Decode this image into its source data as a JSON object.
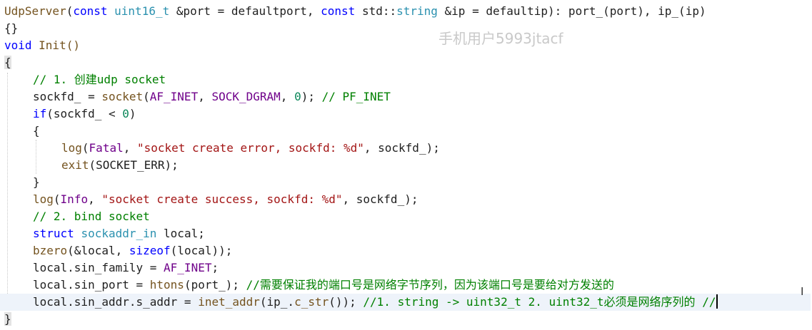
{
  "watermark": "手机用户5993jtacf",
  "cursor_glyph": "I",
  "code": {
    "l1": {
      "a": "UdpServer",
      "b": "(",
      "c": "const",
      "d": " ",
      "e": "uint16_t",
      "f": " &port = defaultport, ",
      "g": "const",
      "h": " std::",
      "i": "string",
      "j": " &ip = defaultip): port_(port), ip_(ip)"
    },
    "l2": "{}",
    "l3_kw": "void",
    "l3_rest": " Init()",
    "l4": "{",
    "l5": "// 1. 创建udp socket",
    "l6": {
      "a": "sockfd_ = ",
      "b": "socket",
      "c": "(",
      "d": "AF_INET",
      "e": ", ",
      "f": "SOCK_DGRAM",
      "g": ", ",
      "h": "0",
      "i": "); ",
      "j": "// PF_INET"
    },
    "l7": {
      "a": "if",
      "b": "(sockfd_ < ",
      "c": "0",
      "d": ")"
    },
    "l8": "{",
    "l9": {
      "a": "log",
      "b": "(",
      "c": "Fatal",
      "d": ", ",
      "e": "\"socket create error, sockfd: %d\"",
      "f": ", sockfd_);"
    },
    "l10": {
      "a": "exit",
      "b": "(SOCKET_ERR);"
    },
    "l11": "}",
    "l12": {
      "a": "log",
      "b": "(",
      "c": "Info",
      "d": ", ",
      "e": "\"socket create success, sockfd: %d\"",
      "f": ", sockfd_);"
    },
    "l13": "// 2. bind socket",
    "l14": {
      "a": "struct",
      "b": " ",
      "c": "sockaddr_in",
      "d": " local;"
    },
    "l15": {
      "a": "bzero",
      "b": "(&local, ",
      "c": "sizeof",
      "d": "(local));"
    },
    "l16": {
      "a": "local.sin_family = ",
      "b": "AF_INET",
      "c": ";"
    },
    "l17": {
      "a": "local.sin_port = ",
      "b": "htons",
      "c": "(port_); ",
      "d": "//需要保证我的端口号是网络字节序列，因为该端口号是要给对方发送的"
    },
    "l18": {
      "a": "local.sin_addr.s_addr = ",
      "b": "inet_addr",
      "c": "(ip_.",
      "d": "c_str",
      "e": "()); ",
      "f": "//1. string -> uint32_t 2. uint32_t必须是网络序列的 //"
    },
    "l19": "}"
  }
}
